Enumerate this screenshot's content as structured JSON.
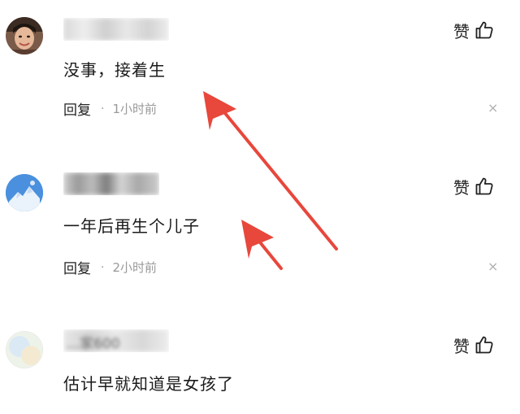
{
  "comments": [
    {
      "username": "",
      "content": "没事，接着生",
      "like_label": "赞",
      "reply_label": "回复",
      "separator": "·",
      "time": "1小时前",
      "close_glyph": "×"
    },
    {
      "username": "",
      "content": "一年后再生个儿子",
      "like_label": "赞",
      "reply_label": "回复",
      "separator": "·",
      "time": "2小时前",
      "close_glyph": "×"
    },
    {
      "username": "...家600",
      "content": "估计早就知道是女孩了",
      "like_label": "赞"
    }
  ],
  "icons": {
    "like": "thumbs-up-icon",
    "close": "close-icon"
  },
  "colors": {
    "arrow": "#e8473c",
    "meta_gray": "#999999",
    "text": "#1a1a1a"
  }
}
